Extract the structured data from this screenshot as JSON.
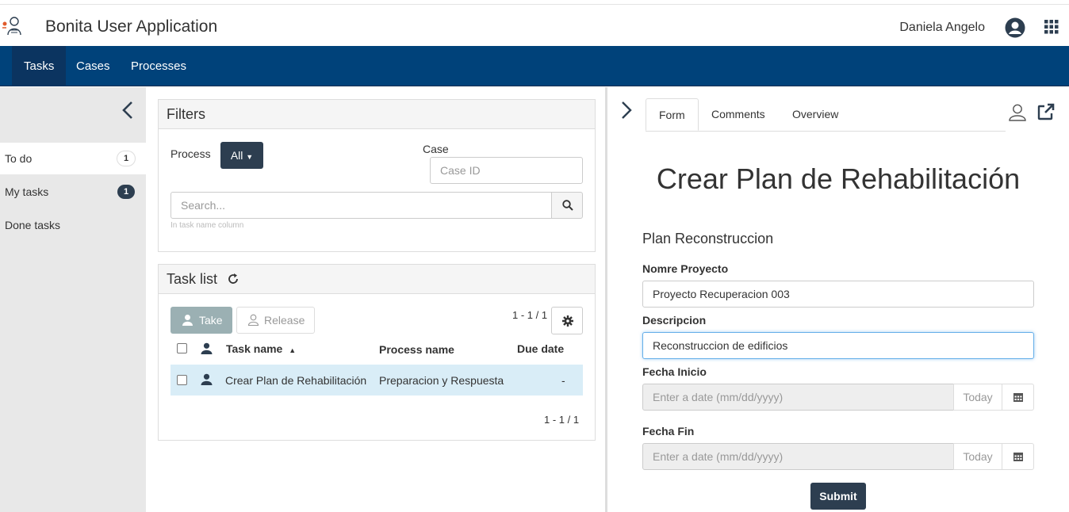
{
  "header": {
    "app_title": "Bonita User Application",
    "user_name": "Daniela Angelo"
  },
  "nav": {
    "items": [
      {
        "label": "Tasks",
        "active": true
      },
      {
        "label": "Cases"
      },
      {
        "label": "Processes"
      }
    ]
  },
  "sidebar": {
    "items": [
      {
        "label": "To do",
        "count": "1",
        "active": true
      },
      {
        "label": "My tasks",
        "count": "1"
      },
      {
        "label": "Done tasks"
      }
    ]
  },
  "filters": {
    "title": "Filters",
    "process_label": "Process",
    "process_value": "All",
    "case_label": "Case",
    "case_placeholder": "Case ID",
    "search_placeholder": "Search...",
    "search_hint": "In task name column"
  },
  "task_list": {
    "title": "Task list",
    "take_label": "Take",
    "release_label": "Release",
    "pager_top": "1 - 1 / 1",
    "pager_bottom": "1 - 1 / 1",
    "columns": [
      "Task name",
      "Process name",
      "Due date"
    ],
    "rows": [
      {
        "task_name": "Crear Plan de Rehabilitación",
        "process_name": "Preparacion y Respuesta",
        "due_date": "-"
      }
    ]
  },
  "detail": {
    "tabs": [
      {
        "label": "Form",
        "active": true
      },
      {
        "label": "Comments"
      },
      {
        "label": "Overview"
      }
    ],
    "form": {
      "title": "Crear Plan de Rehabilitación",
      "subtitle": "Plan Reconstruccion",
      "field1_label": "Nomre Proyecto",
      "field1_value": "Proyecto Recuperacion 003",
      "field2_label": "Descripcion",
      "field2_value": "Reconstruccion de edificios",
      "field3_label": "Fecha Inicio",
      "field3_placeholder": "Enter a date (mm/dd/yyyy)",
      "field4_label": "Fecha Fin",
      "field4_placeholder": "Enter a date (mm/dd/yyyy)",
      "today_label": "Today",
      "submit_label": "Submit"
    }
  },
  "colors": {
    "nav_bg": "#00427a",
    "dark_button": "#2d3e50",
    "selected_row": "#d9edf7"
  }
}
